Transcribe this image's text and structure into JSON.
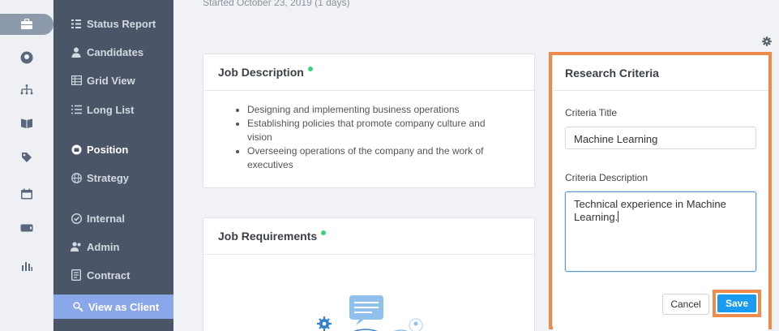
{
  "header": {
    "started_text": "Started October 23, 2019 (1 days)"
  },
  "rail": {
    "items": [
      {
        "icon": "briefcase-icon",
        "active": true
      },
      {
        "icon": "user-circle-icon"
      },
      {
        "icon": "org-chart-icon"
      },
      {
        "icon": "book-icon"
      },
      {
        "icon": "tags-icon"
      },
      {
        "icon": "calendar-icon"
      },
      {
        "icon": "ticket-icon"
      },
      {
        "icon": "bar-chart-icon"
      }
    ]
  },
  "nav": {
    "items": [
      {
        "label": "Status Report",
        "icon": "status-report-icon"
      },
      {
        "label": "Candidates",
        "icon": "user-icon"
      },
      {
        "label": "Grid View",
        "icon": "grid-icon"
      },
      {
        "label": "Long List",
        "icon": "list-icon"
      },
      {
        "label": "Position",
        "icon": "position-icon",
        "current": true
      },
      {
        "label": "Strategy",
        "icon": "globe-icon"
      },
      {
        "label": "Internal",
        "icon": "check-circle-icon"
      },
      {
        "label": "Admin",
        "icon": "users-icon"
      },
      {
        "label": "Contract",
        "icon": "contract-icon"
      },
      {
        "label": "View as Client",
        "icon": "key-icon"
      }
    ],
    "client_bg": "#8aa7ea"
  },
  "job_description": {
    "title": "Job Description",
    "bullets": [
      "Designing and implementing business operations",
      "Establishing policies that promote company culture and vision",
      "Overseeing operations of the company and the work of executives"
    ]
  },
  "job_requirements": {
    "title": "Job Requirements"
  },
  "research_criteria": {
    "title": "Research Criteria",
    "criteria_title_label": "Criteria Title",
    "criteria_title_value": "Machine Learning",
    "criteria_description_label": "Criteria Description",
    "criteria_description_value": "Technical experience in Machine Learning.",
    "cancel_label": "Cancel",
    "save_label": "Save"
  },
  "colors": {
    "highlight": "#ef8a4d",
    "save": "#1a9bf0",
    "status_dot": "#3dd37a"
  }
}
